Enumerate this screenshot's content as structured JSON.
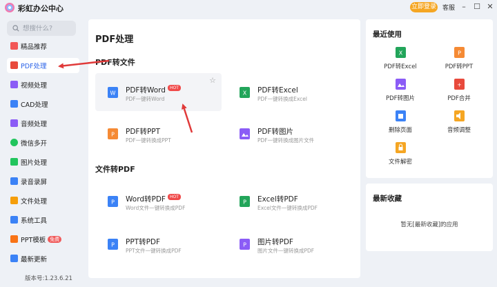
{
  "window": {
    "title": "彩虹办公中心",
    "login_label": "立即登录",
    "service_label": "客服",
    "minimize_glyph": "–",
    "maximize_glyph": "☐",
    "close_glyph": "✕"
  },
  "sidebar": {
    "search_placeholder": "想搜什么?",
    "items": [
      {
        "label": "精品推荐",
        "icon": "thumbs-up-icon",
        "color": "#f25757"
      },
      {
        "label": "PDF处理",
        "icon": "pdf-icon",
        "color": "#e84a3c"
      },
      {
        "label": "视频处理",
        "icon": "video-icon",
        "color": "#8b5cf6"
      },
      {
        "label": "CAD处理",
        "icon": "cad-icon",
        "color": "#3b82f6"
      },
      {
        "label": "音频处理",
        "icon": "audio-icon",
        "color": "#8b5cf6"
      },
      {
        "label": "微信多开",
        "icon": "wechat-icon",
        "color": "#22c55e"
      },
      {
        "label": "图片处理",
        "icon": "image-icon",
        "color": "#22c55e"
      },
      {
        "label": "录音录屏",
        "icon": "mic-icon",
        "color": "#3b82f6"
      },
      {
        "label": "文件处理",
        "icon": "folder-icon",
        "color": "#f59e0b"
      },
      {
        "label": "系统工具",
        "icon": "gear-icon",
        "color": "#3b82f6"
      },
      {
        "label": "PPT模板",
        "icon": "ppt-icon",
        "color": "#f97316",
        "badge": "免费"
      },
      {
        "label": "最新更新",
        "icon": "update-icon",
        "color": "#3b82f6"
      }
    ],
    "version": "版本号:1.23.6.21"
  },
  "main": {
    "title": "PDF处理",
    "sections": [
      {
        "title": "PDF转文件",
        "cards": [
          {
            "title": "PDF转Word",
            "sub": "PDF一键转Word",
            "hot": "HOT",
            "icon": "pdf-to-word-icon",
            "color": "#3b82f6"
          },
          {
            "title": "PDF转Excel",
            "sub": "PDF一键转换成Excel",
            "icon": "pdf-to-excel-icon",
            "color": "#22a55a"
          },
          {
            "title": "PDF转PPT",
            "sub": "PDF一键转换成PPT",
            "icon": "pdf-to-ppt-icon",
            "color": "#f58a34"
          },
          {
            "title": "PDF转图片",
            "sub": "PDF一键转换成图片文件",
            "icon": "pdf-to-image-icon",
            "color": "#8b5cf6"
          }
        ]
      },
      {
        "title": "文件转PDF",
        "cards": [
          {
            "title": "Word转PDF",
            "sub": "Word文件一键转换成PDF",
            "hot": "HOT",
            "icon": "word-to-pdf-icon",
            "color": "#3b82f6"
          },
          {
            "title": "Excel转PDF",
            "sub": "Excel文件一键转换成PDF",
            "icon": "excel-to-pdf-icon",
            "color": "#22a55a"
          },
          {
            "title": "PPT转PDF",
            "sub": "PPT文件一键转换成PDF",
            "icon": "ppt-to-pdf-icon",
            "color": "#3b82f6"
          },
          {
            "title": "图片转PDF",
            "sub": "图片文件一键转换成PDF",
            "icon": "image-to-pdf-icon",
            "color": "#8b5cf6"
          }
        ]
      }
    ]
  },
  "recent": {
    "title": "最近使用",
    "tools": [
      {
        "label": "PDF转Excel",
        "icon": "pdf-to-excel-icon",
        "color": "#22a55a"
      },
      {
        "label": "PDF转PPT",
        "icon": "pdf-to-ppt-icon",
        "color": "#f58a34"
      },
      {
        "label": "PDF转图片",
        "icon": "pdf-to-image-icon",
        "color": "#8b5cf6"
      },
      {
        "label": "PDF合并",
        "icon": "pdf-merge-icon",
        "color": "#e84a3c"
      },
      {
        "label": "删除页面",
        "icon": "delete-page-icon",
        "color": "#3b82f6"
      },
      {
        "label": "音频调整",
        "icon": "audio-adjust-icon",
        "color": "#f5a623"
      },
      {
        "label": "文件解密",
        "icon": "file-decrypt-icon",
        "color": "#f5a623"
      }
    ]
  },
  "favorites": {
    "title": "最新收藏",
    "empty_text": "暂无[最新收藏]的应用"
  },
  "colors": {
    "accent": "#2a62e8",
    "annotation": "#e03a3a",
    "login": "#f5a623"
  }
}
